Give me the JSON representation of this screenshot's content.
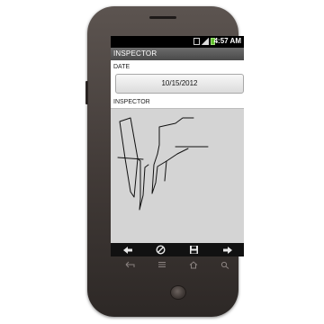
{
  "status_bar": {
    "time": "4:57 AM",
    "icons": [
      "sim-icon",
      "signal-bars-icon",
      "battery-icon"
    ]
  },
  "app": {
    "title": "INSPECTOR"
  },
  "form": {
    "date_label": "DATE",
    "date_value": "10/15/2012",
    "inspector_label": "INSPECTOR"
  },
  "action_bar": {
    "buttons": [
      "back-arrow-icon",
      "cancel-icon",
      "save-icon",
      "forward-arrow-icon"
    ]
  },
  "hardware_keys": [
    "back-icon",
    "menu-icon",
    "home-icon",
    "search-icon"
  ],
  "colors": {
    "title_bar": "#555555",
    "signature_pad": "#d4d4d4",
    "action_bar": "#111111",
    "phone_body": "#4a423f"
  }
}
